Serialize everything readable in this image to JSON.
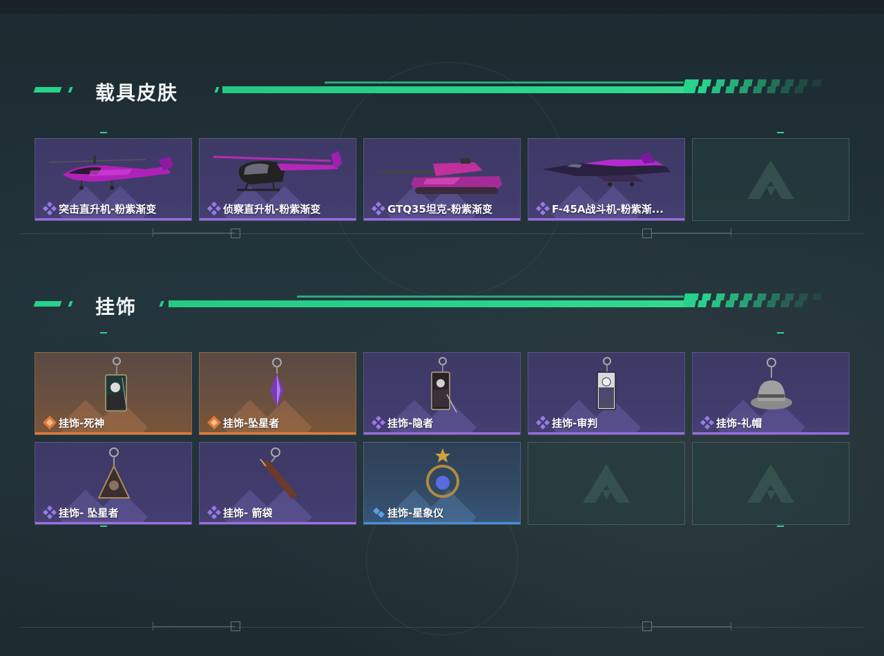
{
  "sections": [
    {
      "title": "载具皮肤",
      "items": [
        {
          "name": "突击直升机-粉紫渐变",
          "rarity": "purple",
          "art": "attack-helicopter"
        },
        {
          "name": "侦察直升机-粉紫渐变",
          "rarity": "purple",
          "art": "scout-helicopter"
        },
        {
          "name": "GTQ35坦克-粉紫渐变",
          "rarity": "purple",
          "art": "tank"
        },
        {
          "name": "F-45A战斗机-粉紫渐...",
          "rarity": "purple",
          "art": "fighter-jet"
        },
        {
          "name": "",
          "rarity": "empty",
          "art": "empty-slot"
        }
      ]
    },
    {
      "title": "挂饰",
      "items": [
        {
          "name": "挂饰-死神",
          "rarity": "orange",
          "art": "reaper-card-charm"
        },
        {
          "name": "挂饰-坠星者",
          "rarity": "orange",
          "art": "crystal-charm"
        },
        {
          "name": "挂饰-隐者",
          "rarity": "purple",
          "art": "hermit-card-charm"
        },
        {
          "name": "挂饰-审判",
          "rarity": "purple",
          "art": "judgement-card-charm"
        },
        {
          "name": "挂饰-礼帽",
          "rarity": "purple",
          "art": "hat-charm"
        },
        {
          "name": "挂饰- 坠星者",
          "rarity": "purple",
          "art": "triangle-charm"
        },
        {
          "name": "挂饰- 箭袋",
          "rarity": "purple",
          "art": "quiver-charm"
        },
        {
          "name": "挂饰-星象仪",
          "rarity": "blue",
          "art": "orrery-charm"
        },
        {
          "name": "",
          "rarity": "empty",
          "art": "empty-slot"
        },
        {
          "name": "",
          "rarity": "empty",
          "art": "empty-slot"
        }
      ]
    }
  ],
  "colors": {
    "accent_green": "#27d28b",
    "rarity_purple": "#9a6fe0",
    "rarity_orange": "#e07a3a",
    "rarity_blue": "#4a90d6"
  }
}
